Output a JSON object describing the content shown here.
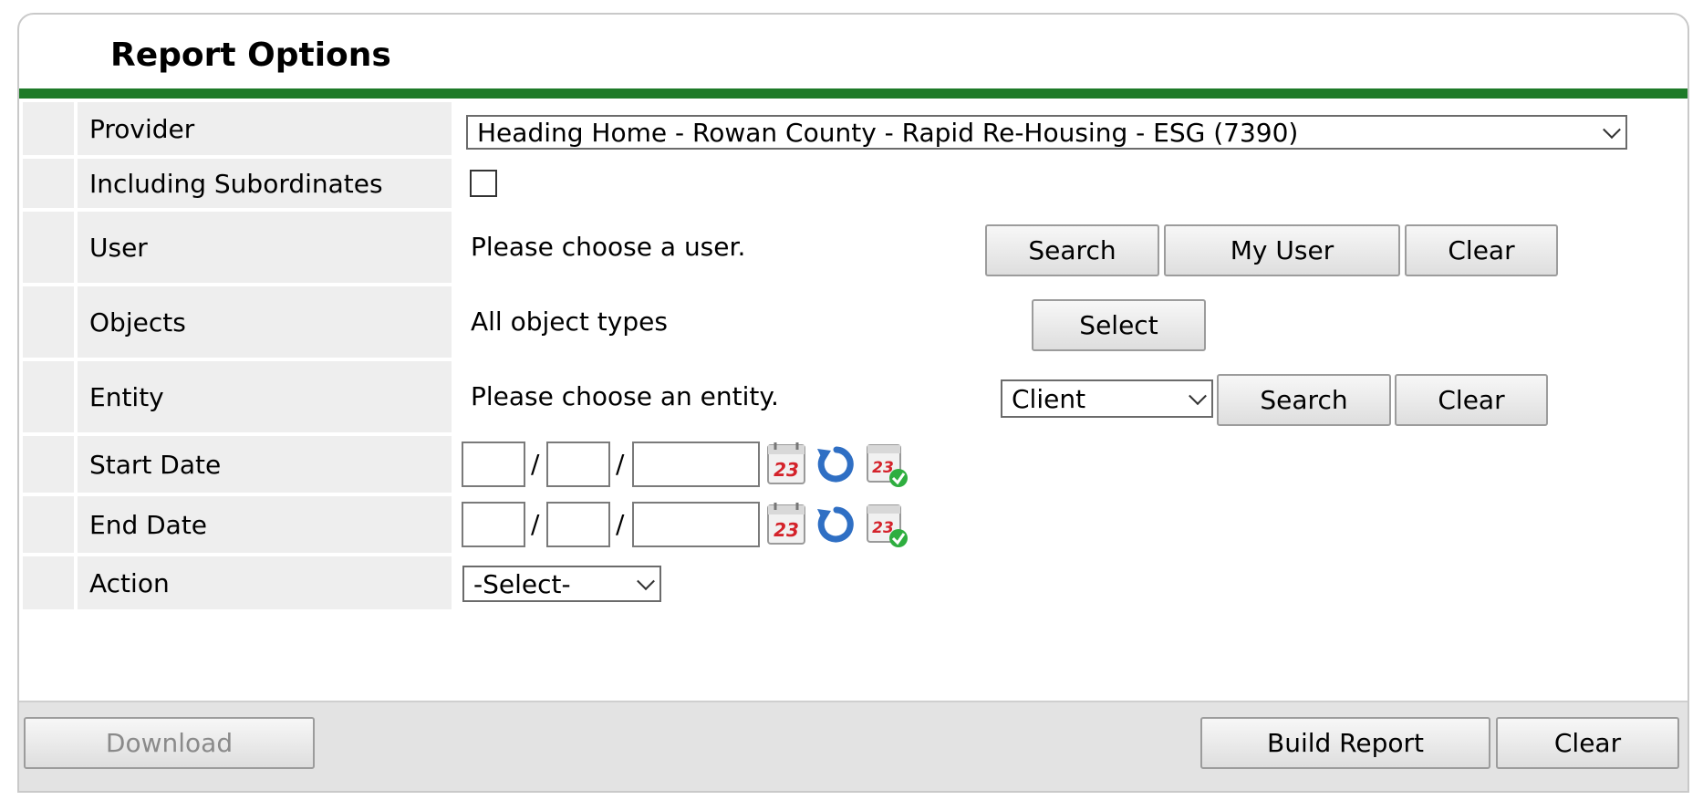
{
  "panel": {
    "title": "Report Options"
  },
  "fields": {
    "provider": {
      "label": "Provider",
      "selected": "Heading Home - Rowan County - Rapid Re-Housing - ESG (7390)"
    },
    "subordinates": {
      "label": "Including Subordinates",
      "checked": false
    },
    "user": {
      "label": "User",
      "value": "Please choose a user.",
      "search": "Search",
      "my_user": "My User",
      "clear": "Clear"
    },
    "objects": {
      "label": "Objects",
      "value": "All object types",
      "select": "Select"
    },
    "entity": {
      "label": "Entity",
      "value": "Please choose an entity.",
      "type_selected": "Client",
      "search": "Search",
      "clear": "Clear"
    },
    "start_date": {
      "label": "Start Date",
      "month": "",
      "day": "",
      "year": "",
      "sep": "/",
      "cal_text": "23"
    },
    "end_date": {
      "label": "End Date",
      "month": "",
      "day": "",
      "year": "",
      "sep": "/",
      "cal_text": "23"
    },
    "action": {
      "label": "Action",
      "selected": "-Select-"
    }
  },
  "footer": {
    "download": "Download",
    "build_report": "Build Report",
    "clear": "Clear"
  },
  "colors": {
    "accent_bar": "#1e7a28",
    "label_bg": "#eeeeee",
    "footer_bg": "#e3e3e3"
  }
}
